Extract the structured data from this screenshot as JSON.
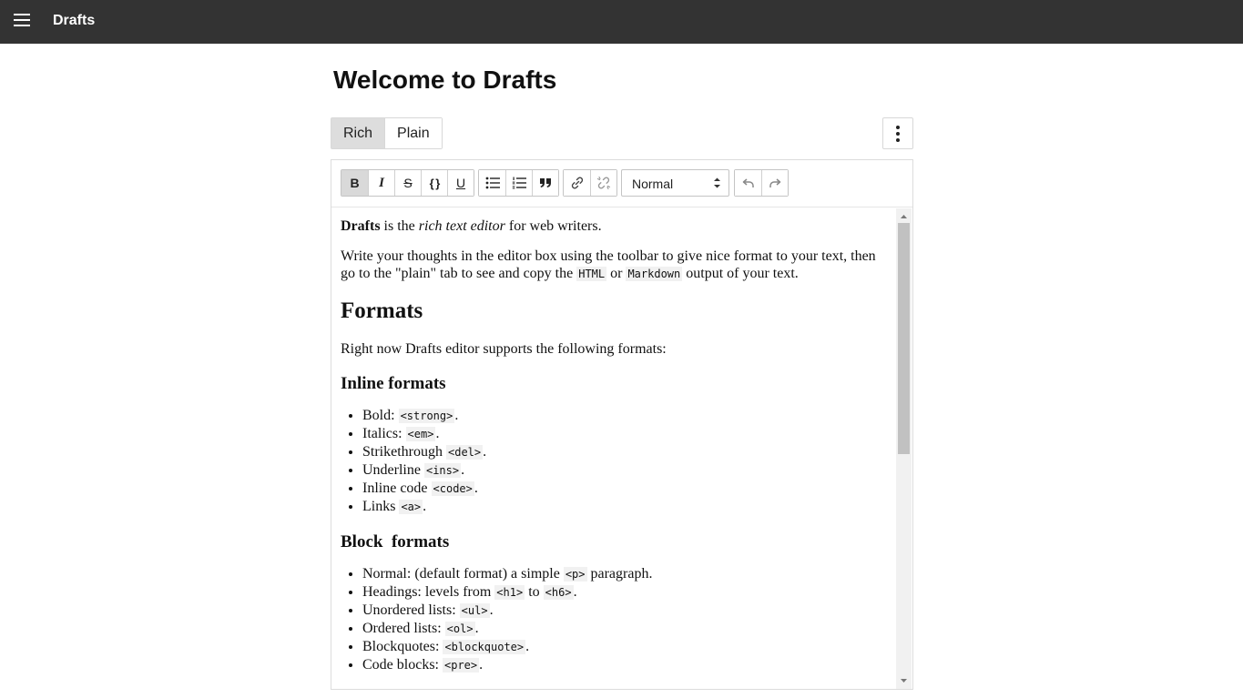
{
  "app": {
    "title": "Drafts"
  },
  "page": {
    "title": "Welcome to Drafts"
  },
  "tabs": [
    {
      "label": "Rich",
      "active": true
    },
    {
      "label": "Plain",
      "active": false
    }
  ],
  "toolbar": {
    "bold": "B",
    "italic": "I",
    "strike": "S",
    "code": "{ }",
    "underline": "U",
    "block_select": {
      "selected": "Normal"
    }
  },
  "icons": {
    "menu": "hamburger-icon",
    "more": "vertical-dots-icon",
    "bullet_list": "bulleted-list-icon",
    "numbered_list": "numbered-list-icon",
    "quote": "quote-icon",
    "link": "link-icon",
    "unlink": "unlink-icon",
    "undo": "undo-icon",
    "redo": "redo-icon"
  },
  "colors": {
    "appbar_bg": "#333333",
    "active_tab_bg": "#dddddd",
    "active_toolbar_btn_bg": "#d9d9d9",
    "code_bg": "#f1f1f1"
  },
  "content": {
    "intro": {
      "bold": "Drafts",
      "text1": " is the ",
      "italic": "rich text editor",
      "text2": " for web writers."
    },
    "para2": {
      "text1": "Write your thoughts in the editor box using the toolbar to give nice format to your text, then go to the \"plain\" tab to see and copy the ",
      "code1": "HTML",
      "text2": " or ",
      "code2": "Markdown",
      "text3": " output of your text."
    },
    "formats_heading": "Formats",
    "formats_text": "Right now  Drafts editor supports the following formats:",
    "inline_heading": "Inline formats",
    "inline_items": [
      {
        "label": "Bold: ",
        "code": "<strong>",
        "end": "."
      },
      {
        "label": "Italics: ",
        "code": "<em>",
        "end": "."
      },
      {
        "label": "Strikethrough ",
        "code": "<del>",
        "end": "."
      },
      {
        "label": "Underline ",
        "code": "<ins>",
        "end": "."
      },
      {
        "label": "Inline code ",
        "code": "<code>",
        "end": "."
      },
      {
        "label": "Links ",
        "code": "<a>",
        "end": "."
      }
    ],
    "block_heading": "Block  formats",
    "block_items": [
      {
        "label": "Normal: (default format) a simple ",
        "code": "<p>",
        "mid": "",
        "code2": "",
        "end": " paragraph."
      },
      {
        "label": "Headings: levels from ",
        "code": "<h1>",
        "mid": " to ",
        "code2": "<h6>",
        "end": "."
      },
      {
        "label": "Unordered lists: ",
        "code": "<ul>",
        "mid": "",
        "code2": "",
        "end": "."
      },
      {
        "label": "Ordered lists: ",
        "code": "<ol>",
        "mid": "",
        "code2": "",
        "end": "."
      },
      {
        "label": "Blockquotes: ",
        "code": "<blockquote>",
        "mid": "",
        "code2": "",
        "end": "."
      },
      {
        "label": "Code blocks: ",
        "code": "<pre>",
        "mid": "",
        "code2": "",
        "end": "."
      }
    ]
  }
}
